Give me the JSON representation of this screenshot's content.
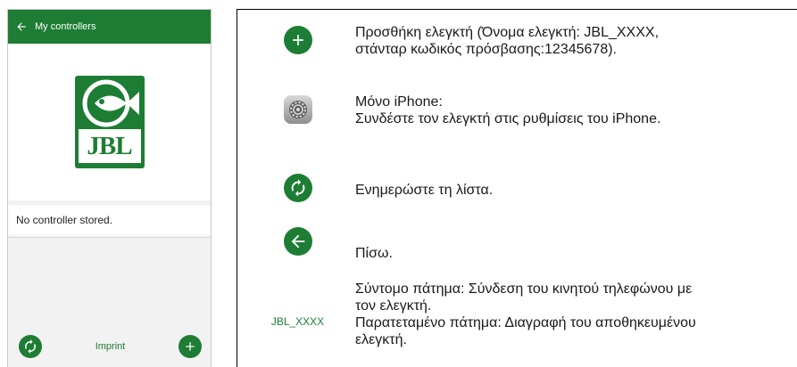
{
  "phone": {
    "appbar": {
      "back_icon": "arrow-left-icon",
      "title": "My controllers"
    },
    "logo": {
      "text": "JBL"
    },
    "empty_message": "No controller stored.",
    "bottom_bar": {
      "refresh_icon": "refresh-icon",
      "imprint_label": "Imprint",
      "add_icon": "plus-icon"
    }
  },
  "legend": {
    "rows": [
      {
        "icon": "plus-icon",
        "text": "Προσθήκη ελεγκτή (Όνομα ελεγκτή: JBL_XXXX,\nστάνταρ κωδικός πρόσβασης:12345678)."
      },
      {
        "icon": "ios-settings-icon",
        "text": "Μόνο iPhone:\nΣυνδέστε τον ελεγκτή στις ρυθμίσεις του iPhone."
      },
      {
        "icon": "refresh-icon",
        "text": "Ενημερώστε τη λίστα."
      },
      {
        "icon": "arrow-left-icon",
        "text": "Πίσω."
      },
      {
        "icon_text": "JBL_XXXX",
        "text": "Σύντομο πάτημα: Σύνδεση του κινητού τηλεφώνου με\nτον ελεγκτή.\nΠαρατεταμένο πάτημα: Διαγραφή του αποθηκευμένου\nελεγκτή."
      }
    ]
  },
  "colors": {
    "brand_green": "#1e7d34",
    "divider": "#d9d9d9"
  }
}
